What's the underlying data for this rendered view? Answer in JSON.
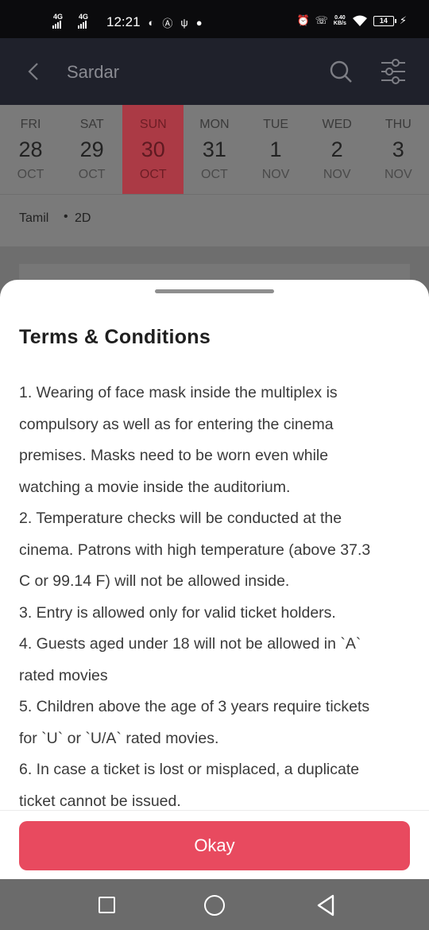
{
  "status_bar": {
    "signal1": "4G",
    "signal2": "4G",
    "time": "12:21",
    "speed_value": "0.40",
    "speed_unit": "KB/s",
    "battery": "14"
  },
  "header": {
    "title": "Sardar"
  },
  "dates": [
    {
      "dow": "FRI",
      "day": "28",
      "mon": "OCT",
      "selected": false
    },
    {
      "dow": "SAT",
      "day": "29",
      "mon": "OCT",
      "selected": false
    },
    {
      "dow": "SUN",
      "day": "30",
      "mon": "OCT",
      "selected": true
    },
    {
      "dow": "MON",
      "day": "31",
      "mon": "OCT",
      "selected": false
    },
    {
      "dow": "TUE",
      "day": "1",
      "mon": "NOV",
      "selected": false
    },
    {
      "dow": "WED",
      "day": "2",
      "mon": "NOV",
      "selected": false
    },
    {
      "dow": "THU",
      "day": "3",
      "mon": "NOV",
      "selected": false
    }
  ],
  "filters": {
    "language": "Tamil",
    "separator": "•",
    "format": "2D"
  },
  "sheet": {
    "title": "Terms & Conditions",
    "lines": [
      "1. Wearing of face mask inside the multiplex is",
      "compulsory as well as for entering the cinema",
      "premises. Masks need to be worn even while",
      "watching a movie inside the auditorium.",
      "2. Temperature checks will be conducted at the",
      "cinema. Patrons with high temperature (above 37.3",
      "C or 99.14 F) will not be allowed inside.",
      "3. Entry is allowed only for valid ticket holders.",
      "4. Guests aged under 18 will not be allowed in `A`",
      "rated movies",
      "5. Children above the age of 3 years require tickets",
      "for `U` or `U/A` rated movies.",
      "6. In case a ticket is lost or misplaced, a duplicate",
      "ticket cannot be issued."
    ],
    "okay_label": "Okay"
  },
  "colors": {
    "accent": "#e84a5f",
    "header_bg": "#1f212b",
    "selected_date": "#ab3a45"
  },
  "icons": {
    "back": "chevron-left-icon",
    "search": "search-icon",
    "filter": "filter-sliders-icon",
    "nav_recents": "square-icon",
    "nav_home": "circle-icon",
    "nav_back": "triangle-back-icon"
  }
}
